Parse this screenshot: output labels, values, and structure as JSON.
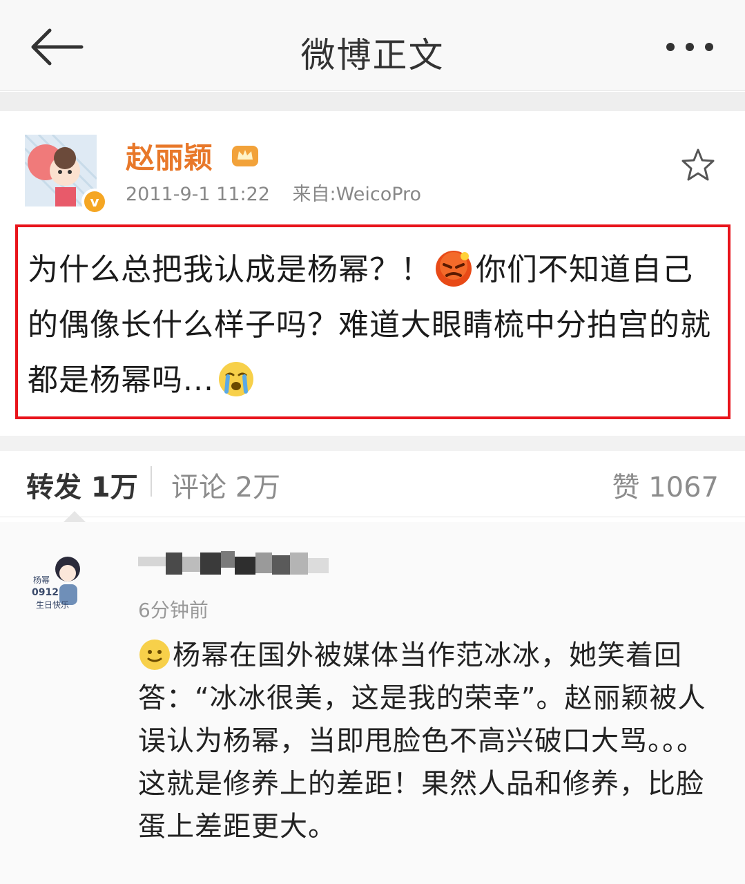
{
  "header": {
    "title": "微博正文",
    "back_icon": "arrow-left-icon",
    "more_icon": "more-dots-icon"
  },
  "post": {
    "author": "赵丽颖",
    "time": "2011-9-1 11:22",
    "source": "来自:WeicoPro",
    "text_1": "为什么总把我认成是杨幂？！",
    "text_2": "你们不知道自己的偶像长什么样子吗？难道大眼睛梳中分拍宫的就都是杨幂吗...",
    "highlight_color": "#e8141b"
  },
  "stats": {
    "repost": "转发 1万",
    "comment": "评论 2万",
    "like": "赞 1067"
  },
  "comment": {
    "avatar_text_1": "杨幂",
    "avatar_text_2": "0912",
    "avatar_text_3": "生日快乐",
    "time": "6分钟前",
    "text": "杨幂在国外被媒体当作范冰冰，她笑着回答：“冰冰很美，这是我的荣幸”。赵丽颖被人误认为杨幂，当即甩脸色不高兴破口大骂。。。这就是修养上的差距！果然人品和修养，比脸蛋上差距更大。"
  }
}
